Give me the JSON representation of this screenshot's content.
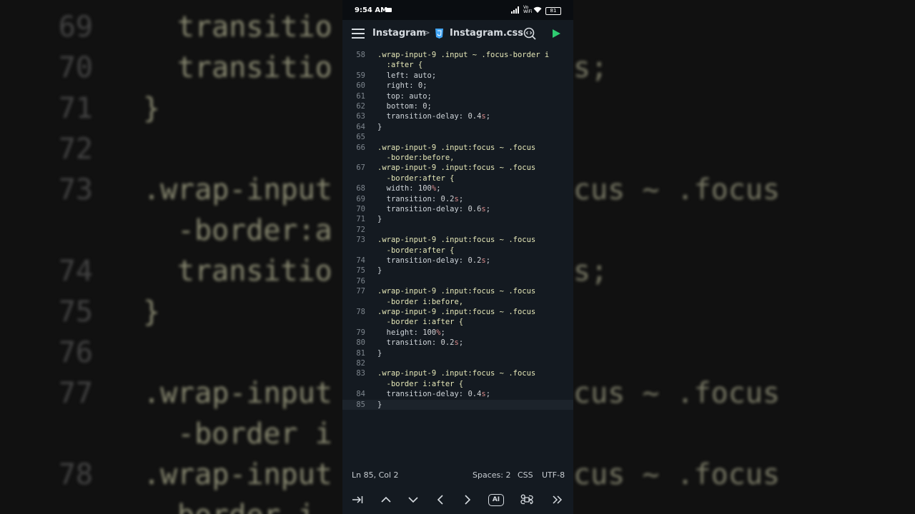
{
  "background": {
    "lines": [
      {
        "num": "69",
        "text": "transitio"
      },
      {
        "num": "70",
        "text": "transitio"
      },
      {
        "num": "71",
        "text": "}"
      },
      {
        "num": "72",
        "text": ""
      },
      {
        "num": "73",
        "text": ".wrap-input"
      },
      {
        "num": "",
        "text": "-border:a"
      },
      {
        "num": "74",
        "text": "transitio"
      },
      {
        "num": "75",
        "text": "}"
      },
      {
        "num": "76",
        "text": ""
      },
      {
        "num": "77",
        "text": ".wrap-input"
      },
      {
        "num": "",
        "text": "-border i"
      },
      {
        "num": "78",
        "text": ".wrap-input"
      },
      {
        "num": "",
        "text": "border i"
      }
    ],
    "right_fragments": [
      {
        "row": 1,
        "text": "s;"
      },
      {
        "row": 4,
        "text": "cus ~ .focus"
      },
      {
        "row": 6,
        "text": "s;"
      },
      {
        "row": 9,
        "text": "cus ~ .focus"
      },
      {
        "row": 11,
        "text": "cus ~ .focus"
      }
    ]
  },
  "statusbar": {
    "time": "9:54 AM",
    "network": "Vo WiFi",
    "battery": "81"
  },
  "toolbar": {
    "project": "Instagram",
    "separator": ">",
    "file": "Instagram.css"
  },
  "editor": {
    "rows": [
      {
        "ln": "58",
        "code": ".wrap-input-9 .input ~ .focus-border i"
      },
      {
        "ln": "",
        "code": "  :after {"
      },
      {
        "ln": "59",
        "code": "  left: auto;"
      },
      {
        "ln": "60",
        "code": "  right: 0;"
      },
      {
        "ln": "61",
        "code": "  top: auto;"
      },
      {
        "ln": "62",
        "code": "  bottom: 0;"
      },
      {
        "ln": "63",
        "code": "  transition-delay: 0.4s;"
      },
      {
        "ln": "64",
        "code": "}"
      },
      {
        "ln": "65",
        "code": ""
      },
      {
        "ln": "66",
        "code": ".wrap-input-9 .input:focus ~ .focus"
      },
      {
        "ln": "",
        "code": "  -border:before,"
      },
      {
        "ln": "67",
        "code": ".wrap-input-9 .input:focus ~ .focus"
      },
      {
        "ln": "",
        "code": "  -border:after {"
      },
      {
        "ln": "68",
        "code": "  width: 100%;"
      },
      {
        "ln": "69",
        "code": "  transition: 0.2s;"
      },
      {
        "ln": "70",
        "code": "  transition-delay: 0.6s;"
      },
      {
        "ln": "71",
        "code": "}"
      },
      {
        "ln": "72",
        "code": ""
      },
      {
        "ln": "73",
        "code": ".wrap-input-9 .input:focus ~ .focus"
      },
      {
        "ln": "",
        "code": "  -border:after {"
      },
      {
        "ln": "74",
        "code": "  transition-delay: 0.2s;"
      },
      {
        "ln": "75",
        "code": "}"
      },
      {
        "ln": "76",
        "code": ""
      },
      {
        "ln": "77",
        "code": ".wrap-input-9 .input:focus ~ .focus"
      },
      {
        "ln": "",
        "code": "  -border i:before,"
      },
      {
        "ln": "78",
        "code": ".wrap-input-9 .input:focus ~ .focus"
      },
      {
        "ln": "",
        "code": "  -border i:after {"
      },
      {
        "ln": "79",
        "code": "  height: 100%;"
      },
      {
        "ln": "80",
        "code": "  transition: 0.2s;"
      },
      {
        "ln": "81",
        "code": "}"
      },
      {
        "ln": "82",
        "code": ""
      },
      {
        "ln": "83",
        "code": ".wrap-input-9 .input:focus ~ .focus"
      },
      {
        "ln": "",
        "code": "  -border i:after {"
      },
      {
        "ln": "84",
        "code": "  transition-delay: 0.4s;"
      },
      {
        "ln": "85",
        "code": "}"
      }
    ],
    "current_line_index": 34
  },
  "footer": {
    "position": "Ln 85, Col 2",
    "spaces": "Spaces: 2",
    "language": "CSS",
    "encoding": "UTF-8"
  },
  "keybar": {
    "ai_label": "AI"
  },
  "colors": {
    "editor_bg": "#141a21",
    "selector": "#e6e8b8",
    "run_green": "#2ecc71",
    "css_icon": "#42a5f5"
  }
}
